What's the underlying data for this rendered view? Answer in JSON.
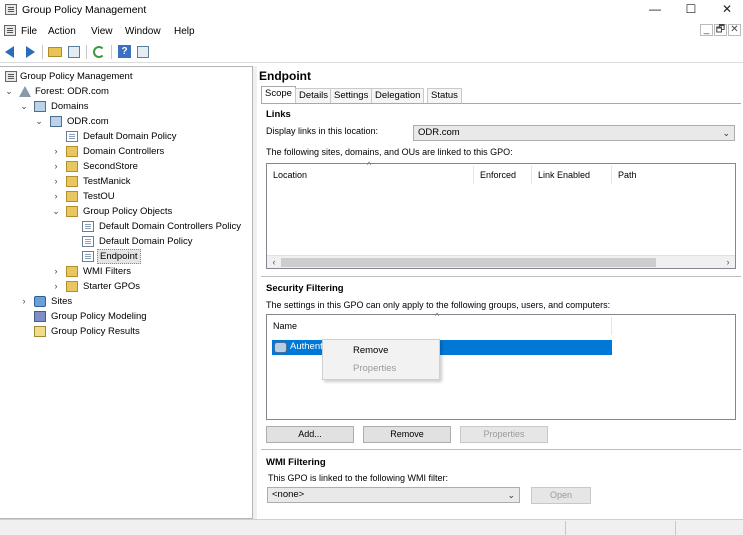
{
  "window": {
    "title": "Group Policy Management",
    "minimize": "—",
    "maximize": "☐",
    "close": "✕"
  },
  "mdi_controls": {
    "minimize": "_",
    "restore": "🗗",
    "close": "✕"
  },
  "menu": [
    "File",
    "Action",
    "View",
    "Window",
    "Help"
  ],
  "toolbar": {
    "back_icon": "back-arrow-icon",
    "forward_icon": "forward-arrow-icon",
    "help_label": "?"
  },
  "tree": {
    "root": "Group Policy Management",
    "forest": "Forest: ODR.com",
    "domains": "Domains",
    "domain": "ODR.com",
    "default_domain_policy": "Default Domain Policy",
    "domain_controllers": "Domain Controllers",
    "second_store": "SecondStore",
    "test_manick": "TestManick",
    "test_ou": "TestOU",
    "gpo_folder": "Group Policy Objects",
    "gpo_ddcp": "Default Domain Controllers Policy",
    "gpo_ddp": "Default Domain Policy",
    "gpo_endpoint": "Endpoint",
    "wmi_filters": "WMI Filters",
    "starter_gpos": "Starter GPOs",
    "sites": "Sites",
    "modeling": "Group Policy Modeling",
    "results": "Group Policy Results"
  },
  "details": {
    "title": "Endpoint",
    "tabs": [
      "Scope",
      "Details",
      "Settings",
      "Delegation",
      "Status"
    ],
    "active_tab": "Scope",
    "links": {
      "heading": "Links",
      "display_label": "Display links in this location:",
      "location_value": "ODR.com",
      "description": "The following sites, domains, and OUs are linked to this GPO:",
      "columns": [
        "Location",
        "Enforced",
        "Link Enabled",
        "Path"
      ]
    },
    "security": {
      "heading": "Security Filtering",
      "description": "The settings in this GPO can only apply to the following groups, users, and computers:",
      "column": "Name",
      "selected_item": "Authentic",
      "buttons": {
        "add": "Add...",
        "remove": "Remove",
        "properties": "Properties"
      }
    },
    "wmi": {
      "heading": "WMI Filtering",
      "description": "This GPO is linked to the following WMI filter:",
      "filter_value": "<none>",
      "open_button": "Open"
    }
  },
  "context_menu": {
    "remove": "Remove",
    "properties": "Properties"
  }
}
